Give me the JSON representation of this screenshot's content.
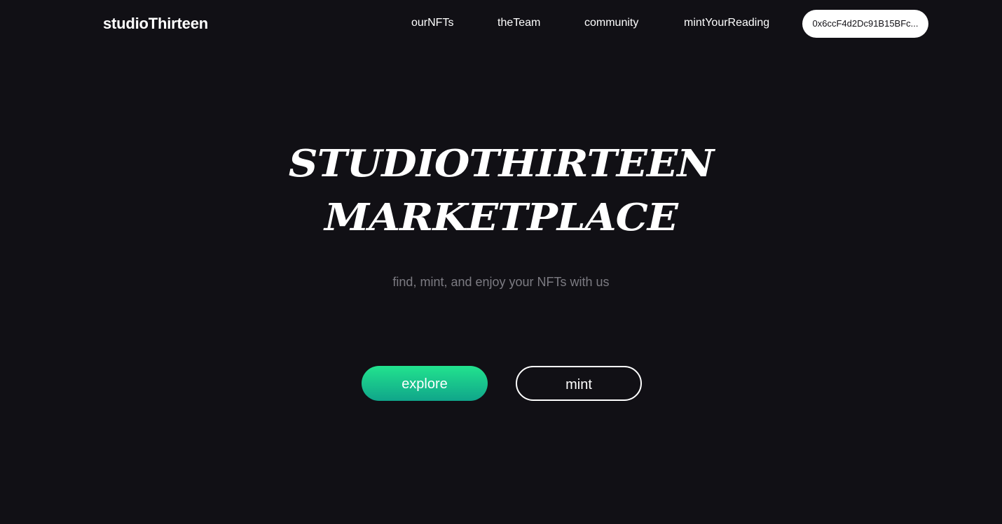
{
  "header": {
    "brand": "studioThirteen",
    "nav": [
      {
        "label": "ourNFTs"
      },
      {
        "label": "theTeam"
      },
      {
        "label": "community"
      },
      {
        "label": "mintYourReading"
      }
    ],
    "wallet_address": "0x6ccF4d2Dc91B15BFc..."
  },
  "hero": {
    "title_line1": "studioThirteen",
    "title_line2": "marketplace",
    "tagline": "find, mint, and enjoy your NFTs with us"
  },
  "actions": {
    "explore_label": "explore",
    "mint_label": "mint"
  },
  "colors": {
    "background": "#111015",
    "accent_gradient_top": "#22e38e",
    "accent_gradient_bottom": "#10a58a",
    "tagline": "#7c7b82"
  }
}
